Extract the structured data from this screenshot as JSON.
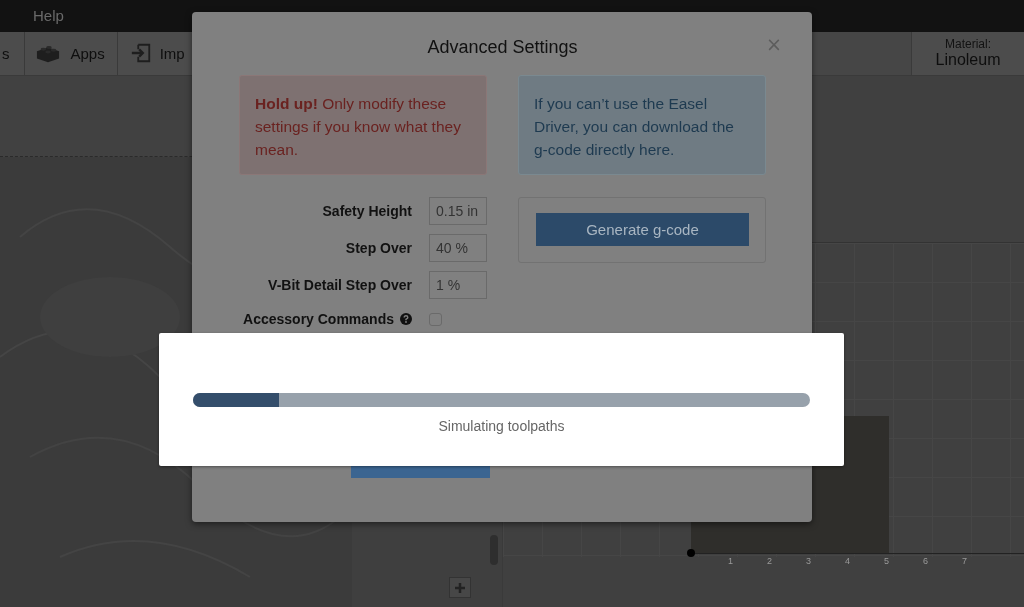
{
  "menu_bar": {
    "items": [
      "Help"
    ]
  },
  "toolbar": {
    "items": [
      {
        "label": "s",
        "kind": "text"
      },
      {
        "label": "Apps",
        "kind": "apps"
      },
      {
        "label": "Imp",
        "kind": "import"
      }
    ],
    "material": {
      "label": "Material:",
      "value": "Linoleum"
    }
  },
  "preview": {
    "axis_labels": [
      "1",
      "2",
      "3",
      "4",
      "5",
      "6",
      "7"
    ]
  },
  "modal": {
    "title": "Advanced Settings",
    "close": "×",
    "warning": "**Hold up!** Only modify these settings if you know what they mean.",
    "info": "If you can’t use the Easel Driver, you can download the g-code directly here.",
    "settings": [
      {
        "label": "Safety Height",
        "kind": "input",
        "value": "0.15 in"
      },
      {
        "label": "Step Over",
        "kind": "input",
        "value": "40 %"
      },
      {
        "label": "V-Bit Detail Step Over",
        "kind": "input",
        "value": "1 %"
      },
      {
        "label": "Accessory Commands",
        "kind": "checkbox",
        "checked": false,
        "help": true
      }
    ],
    "generate_button": "Generate g-code"
  },
  "progress": {
    "level": 0.14,
    "message": "Simulating toolpaths"
  }
}
